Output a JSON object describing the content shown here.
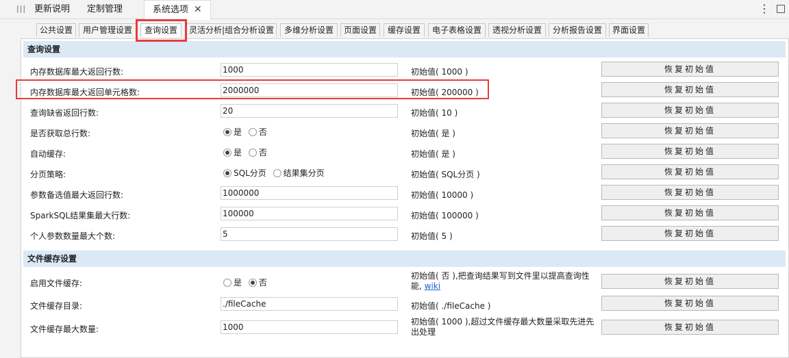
{
  "topbar": {
    "tabs": [
      {
        "label": "更新说明"
      },
      {
        "label": "定制管理"
      },
      {
        "label": "系统选项"
      }
    ]
  },
  "subtabs": [
    {
      "label": "公共设置"
    },
    {
      "label": "用户管理设置"
    },
    {
      "label": "查询设置"
    },
    {
      "label": "灵活分析|组合分析设置"
    },
    {
      "label": "多维分析设置"
    },
    {
      "label": "页面设置"
    },
    {
      "label": "缓存设置"
    },
    {
      "label": "电子表格设置"
    },
    {
      "label": "透视分析设置"
    },
    {
      "label": "分析报告设置"
    },
    {
      "label": "界面设置"
    }
  ],
  "sections": [
    {
      "title": "查询设置",
      "rows": [
        {
          "label": "内存数据库最大返回行数:",
          "type": "input",
          "value": "1000",
          "init": "初始值( 1000 )"
        },
        {
          "label": "内存数据库最大返回单元格数:",
          "type": "input",
          "value": "2000000",
          "init": "初始值( 200000 )"
        },
        {
          "label": "查询缺省返回行数:",
          "type": "input",
          "value": "20",
          "init": "初始值( 10 )"
        },
        {
          "label": "是否获取总行数:",
          "type": "radio",
          "options": [
            "是",
            "否"
          ],
          "selected": 0,
          "init": "初始值( 是 )"
        },
        {
          "label": "自动缓存:",
          "type": "radio",
          "options": [
            "是",
            "否"
          ],
          "selected": 0,
          "init": "初始值( 是 )"
        },
        {
          "label": "分页策略:",
          "type": "radio",
          "options": [
            "SQL分页",
            "结果集分页"
          ],
          "selected": 0,
          "init": "初始值( SQL分页 )"
        },
        {
          "label": "参数备选值最大返回行数:",
          "type": "input",
          "value": "1000000",
          "init": "初始值( 10000 )"
        },
        {
          "label": "SparkSQL结果集最大行数:",
          "type": "input",
          "value": "100000",
          "init": "初始值( 100000 )"
        },
        {
          "label": "个人参数数量最大个数:",
          "type": "input",
          "value": "5",
          "init": "初始值( 5 )"
        }
      ]
    },
    {
      "title": "文件缓存设置",
      "rows": [
        {
          "label": "启用文件缓存:",
          "type": "radio",
          "options": [
            "是",
            "否"
          ],
          "selected": 1,
          "init": "初始值( 否 ),把查询结果写到文件里以提高查询性能,",
          "init_link": "wiki"
        },
        {
          "label": "文件缓存目录:",
          "type": "input",
          "value": "./fileCache",
          "init": "初始值( ./fileCache )"
        },
        {
          "label": "文件缓存最大数量:",
          "type": "input",
          "value": "1000",
          "init": "初始值( 1000 ),超过文件缓存最大数量采取先进先出处理"
        }
      ]
    }
  ],
  "reset_label": "恢复初始值"
}
